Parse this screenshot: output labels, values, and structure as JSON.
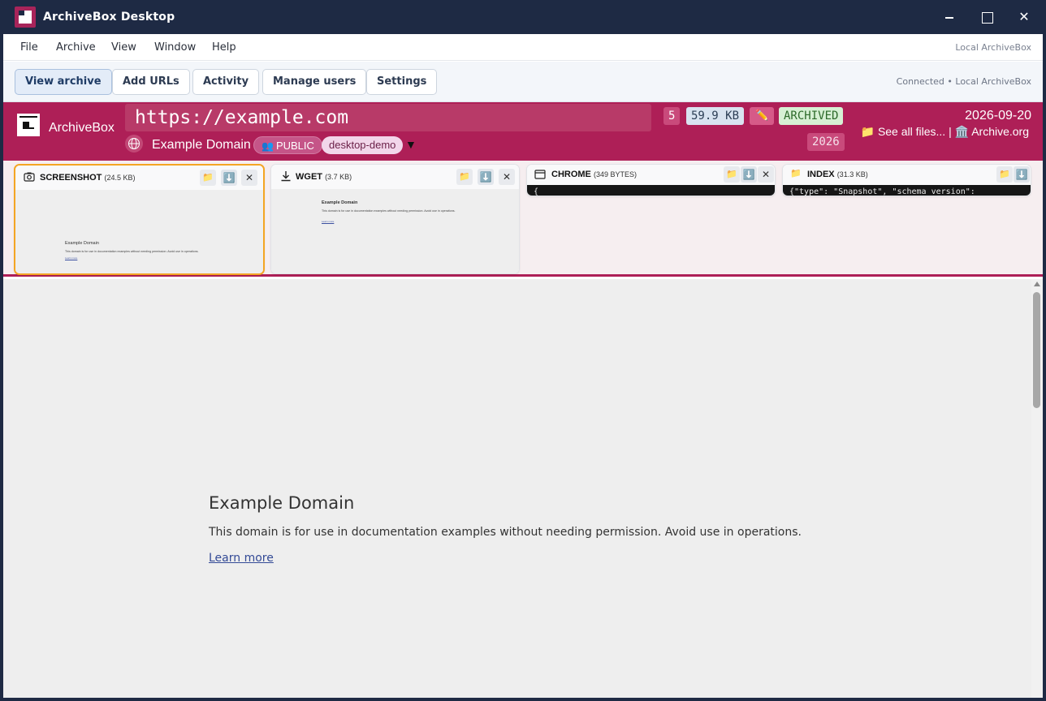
{
  "window": {
    "title": "ArchiveBox Desktop"
  },
  "menubar": {
    "items": [
      "File",
      "Archive",
      "View",
      "Window",
      "Help"
    ],
    "right_label": "Local ArchiveBox"
  },
  "toolbar": {
    "buttons": [
      "View archive",
      "Add URLs",
      "Activity",
      "Manage users",
      "Settings"
    ],
    "active": "View archive",
    "status": "Connected • Local ArchiveBox"
  },
  "snapshot": {
    "brand": "ArchiveBox",
    "url": "https://example.com",
    "title": "Example Domain",
    "visibility": "PUBLIC",
    "tag": "desktop-demo",
    "count": "5",
    "size": "59.9 KB",
    "edit_icon": "pencil-icon",
    "status": "ARCHIVED",
    "year": "2026",
    "date": "2026-09-20",
    "see_all_files": "See all files...",
    "separator": "|",
    "archive_org": "Archive.org"
  },
  "panels": [
    {
      "name": "SCREENSHOT",
      "size": "(24.5 KB)",
      "icon": "camera-icon",
      "selected": true
    },
    {
      "name": "WGET",
      "size": "(3.7 KB)",
      "icon": "download-icon",
      "selected": false
    },
    {
      "name": "CHROME",
      "size": "(349 BYTES)",
      "icon": "browser-window-icon",
      "selected": false,
      "content": "{"
    },
    {
      "name": "INDEX",
      "size": "(31.3 KB)",
      "icon": "folder-icon",
      "selected": false,
      "content": "{\"type\": \"Snapshot\", \"schema_version\":"
    }
  ],
  "preview_page": {
    "title": "Example Domain",
    "body": "This domain is for use in documentation examples without needing permission. Avoid use in operations.",
    "link": "Learn more"
  },
  "viewer_page": {
    "title": "Example Domain",
    "body": "This domain is for use in documentation examples without needing permission. Avoid use in operations.",
    "link": "Learn more"
  },
  "colors": {
    "titlebar": "#1e2a44",
    "brand": "#ae1f57",
    "selected_border": "#f4a523"
  }
}
